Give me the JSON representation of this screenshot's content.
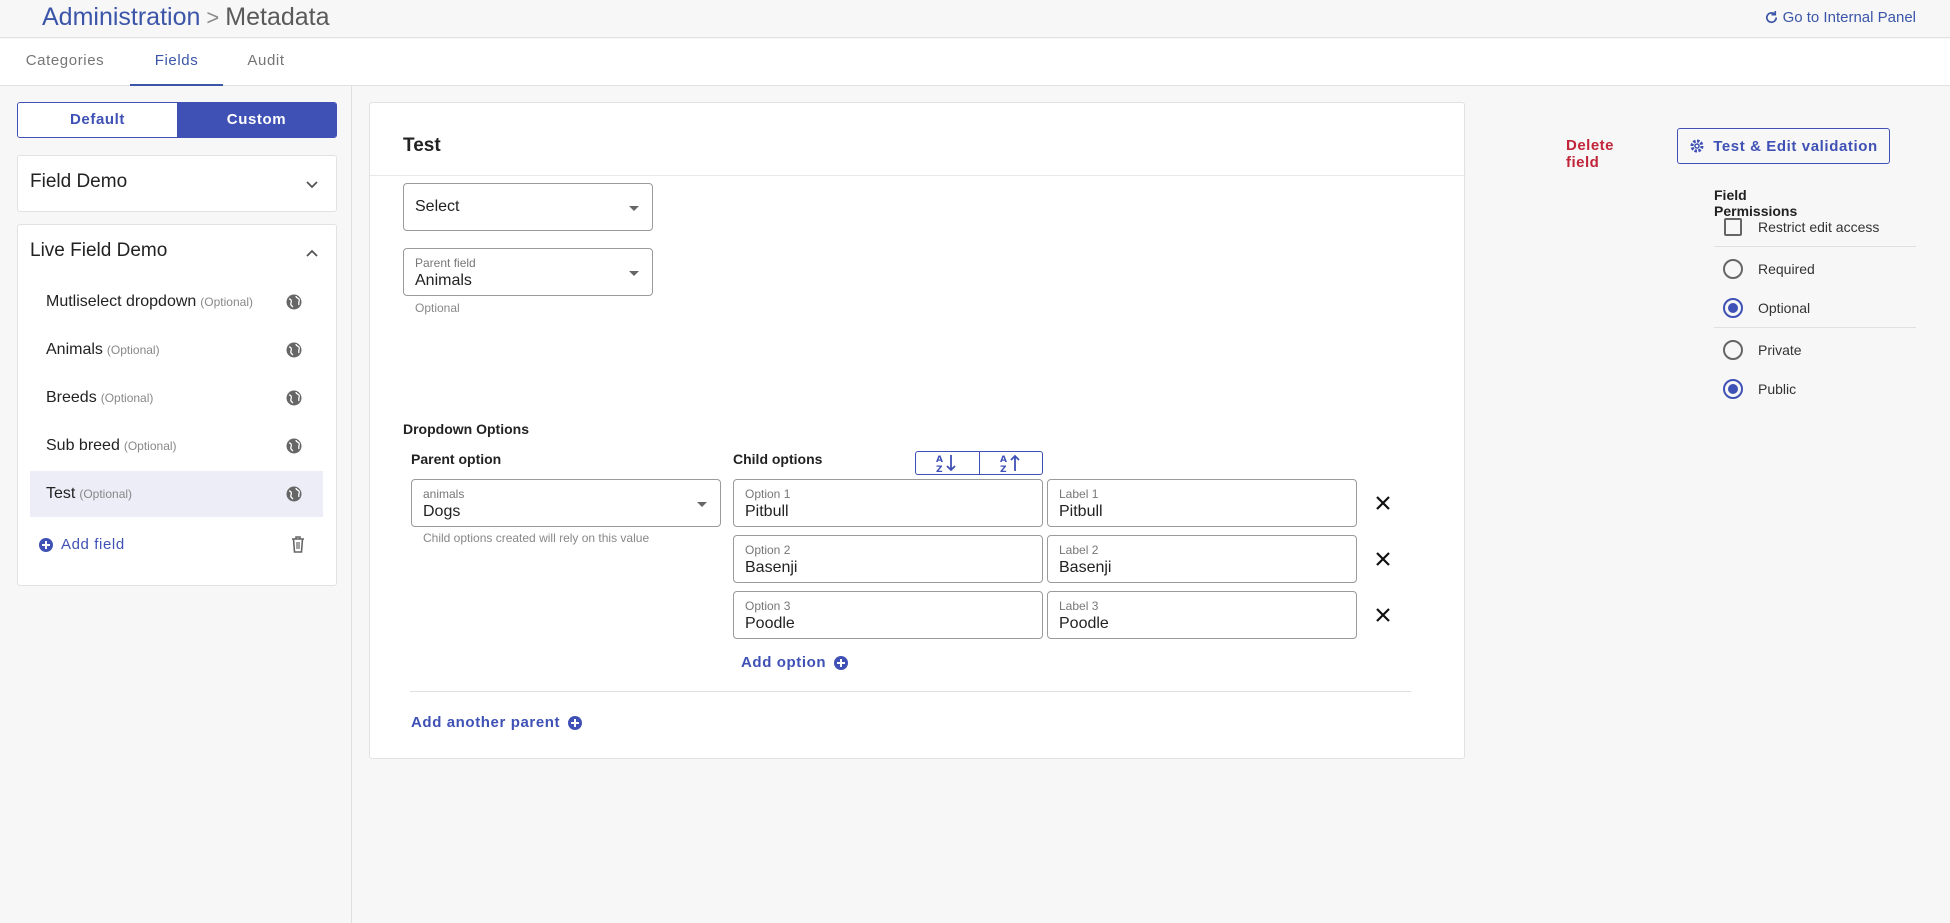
{
  "header": {
    "breadcrumb_root": "Administration",
    "breadcrumb_separator": ">",
    "breadcrumb_current": "Metadata",
    "internal_panel_link": "Go to Internal Panel"
  },
  "tabs": [
    {
      "label": "Categories",
      "active": false
    },
    {
      "label": "Fields",
      "active": true
    },
    {
      "label": "Audit",
      "active": false
    }
  ],
  "sidebar": {
    "toggle": {
      "default_label": "Default",
      "custom_label": "Custom",
      "selected": "Custom"
    },
    "panels": [
      {
        "title": "Field Demo",
        "expanded": false
      },
      {
        "title": "Live Field Demo",
        "expanded": true
      }
    ],
    "fields": [
      {
        "name": "Mutliselect dropdown",
        "tag": "(Optional)"
      },
      {
        "name": "Animals",
        "tag": "(Optional)"
      },
      {
        "name": "Breeds",
        "tag": "(Optional)"
      },
      {
        "name": "Sub breed",
        "tag": "(Optional)"
      },
      {
        "name": "Test",
        "tag": "(Optional)"
      }
    ],
    "selected_field": "Test",
    "add_field_label": "Add field"
  },
  "editor": {
    "title": "Test",
    "delete_label": "Delete field",
    "validation_label": "Test & Edit validation",
    "type_select_value": "Select",
    "parent_field": {
      "label": "Parent field",
      "value": "Animals",
      "helper": "Optional"
    },
    "dropdown_options_title": "Dropdown Options",
    "parent_option_title": "Parent option",
    "child_options_title": "Child options",
    "parent_option_select": {
      "label": "animals",
      "value": "Dogs",
      "helper": "Child options created will rely on this value"
    },
    "child_options": [
      {
        "option_label": "Option 1",
        "option_value": "Pitbull",
        "label_label": "Label 1",
        "label_value": "Pitbull"
      },
      {
        "option_label": "Option 2",
        "option_value": "Basenji",
        "label_label": "Label 2",
        "label_value": "Basenji"
      },
      {
        "option_label": "Option 3",
        "option_value": "Poodle",
        "label_label": "Label 3",
        "label_value": "Poodle"
      }
    ],
    "add_option_label": "Add option",
    "add_parent_label": "Add another parent"
  },
  "permissions": {
    "title": "Field Permissions",
    "restrict_edit_access": {
      "label": "Restrict edit access",
      "checked": false
    },
    "requirement": {
      "required_label": "Required",
      "optional_label": "Optional",
      "selected": "Optional"
    },
    "visibility": {
      "private_label": "Private",
      "public_label": "Public",
      "selected": "Public"
    }
  },
  "colors": {
    "accent": "#3f51b5",
    "link": "#3b55a8",
    "danger": "#c0253a",
    "selected_row": "#ecedf7"
  }
}
